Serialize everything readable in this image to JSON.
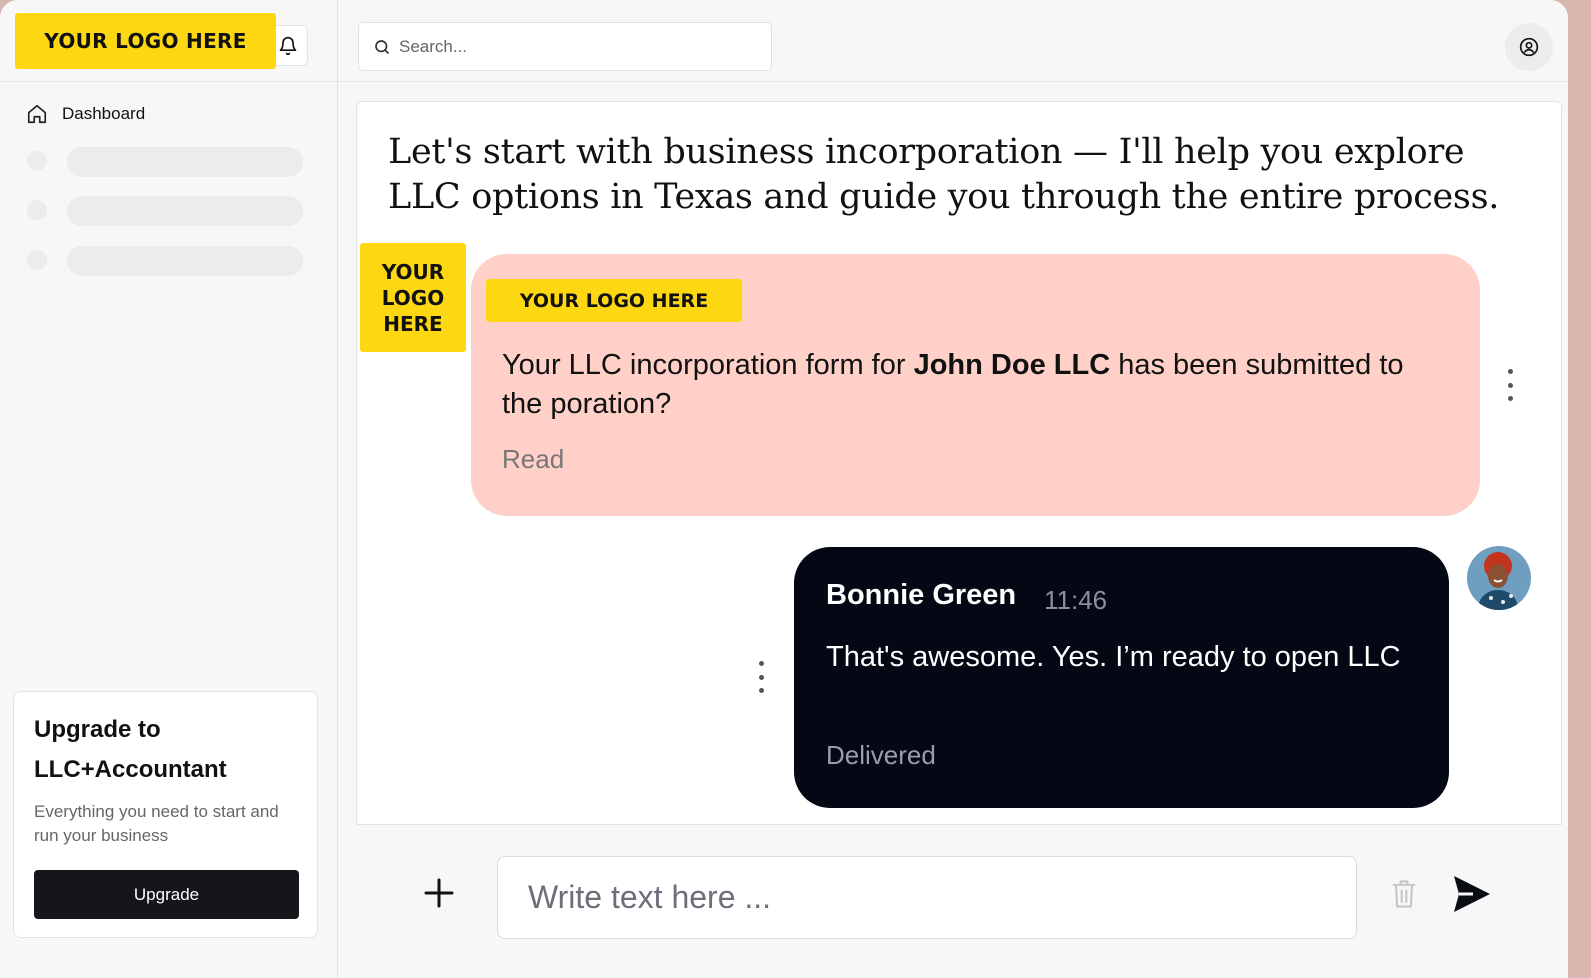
{
  "brand": {
    "logo_text": "YOUR LOGO HERE",
    "logo_stacked": "YOUR\nLOGO\nHERE",
    "accent_color": "#fdd712"
  },
  "header": {
    "search": {
      "placeholder": "Search...",
      "icon": "search-icon"
    },
    "notifications_icon": "bell-icon",
    "profile_icon": "user-circle-icon"
  },
  "sidebar": {
    "items": [
      {
        "label": "Dashboard",
        "icon": "home-icon"
      }
    ],
    "upgrade_card": {
      "title": "Upgrade to LLC+Accountant",
      "description": "Everything you need to start and run your business",
      "button_label": "Upgrade"
    }
  },
  "chat": {
    "intro": "Let's start with business incorporation — I'll help you explore LLC options in Texas and guide you through the entire process.",
    "messages": [
      {
        "sender": "bot",
        "badge": "YOUR LOGO HERE",
        "text_before": "Your LLC incorporation form for ",
        "text_bold": "John Doe LLC",
        "text_after": " has been submitted to the poration?",
        "status": "Read",
        "bubble_color": "#fed0c8"
      },
      {
        "sender": "user",
        "name": "Bonnie Green",
        "time": "11:46",
        "text": "That's awesome. Yes. I’m ready to open LLC",
        "status": "Delivered",
        "bubble_color": "#040815"
      }
    ]
  },
  "composer": {
    "placeholder": "Write text here ...",
    "attach_icon": "plus-icon",
    "delete_icon": "trash-icon",
    "send_icon": "send-icon"
  }
}
